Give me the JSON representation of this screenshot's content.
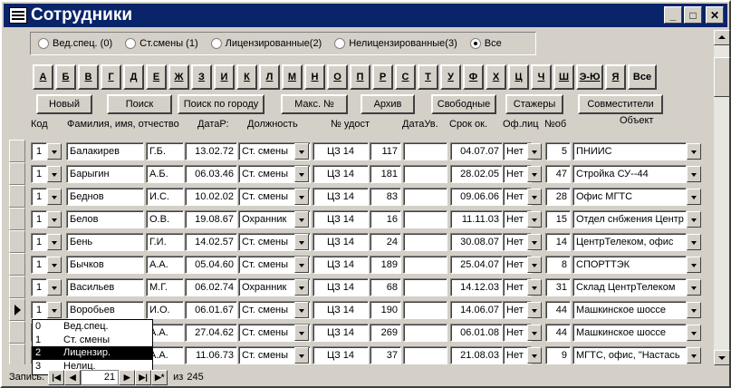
{
  "window": {
    "title": "Сотрудники"
  },
  "filter_options": [
    {
      "label": "Вед.спец. (0)",
      "selected": false
    },
    {
      "label": "Ст.смены (1)",
      "selected": false
    },
    {
      "label": "Лицензированные(2)",
      "selected": false
    },
    {
      "label": "Нелицензированные(3)",
      "selected": false
    },
    {
      "label": "Все",
      "selected": true
    }
  ],
  "letters": [
    "А",
    "Б",
    "В",
    "Г",
    "Д",
    "Е",
    "Ж",
    "З",
    "И",
    "К",
    "Л",
    "М",
    "Н",
    "О",
    "П",
    "Р",
    "С",
    "Т",
    "У",
    "Ф",
    "Х",
    "Ц",
    "Ч",
    "Ш",
    "Э-Ю",
    "Я",
    "Все"
  ],
  "actions": [
    "Новый",
    "Поиск",
    "Поиск по городу",
    "Макс. №",
    "Архив",
    "Свободные",
    "Стажеры",
    "Совместители"
  ],
  "columns": {
    "kod": "Код",
    "fio": "Фамилия, имя, отчество",
    "dob": "ДатаР:",
    "position": "Должность",
    "cert_no": "№ удост",
    "cert_date": "ДатаУв.",
    "term": "Срок ок.",
    "lic": "Оф.лиц",
    "no": "№об",
    "object": "Объект"
  },
  "rows": [
    {
      "kod": "1",
      "surname": "Балакирев",
      "initials": "Г.Б.",
      "dob": "13.02.72",
      "position": "Ст. смены",
      "cert": "ЦЗ 14",
      "num": "117",
      "cert_date": "",
      "term": "04.07.07",
      "lic": "Нет",
      "no": "5",
      "object": "ПНИИС"
    },
    {
      "kod": "1",
      "surname": "Барыгин",
      "initials": "А.Б.",
      "dob": "06.03.46",
      "position": "Ст. смены",
      "cert": "ЦЗ 14",
      "num": "181",
      "cert_date": "",
      "term": "28.02.05",
      "lic": "Нет",
      "no": "47",
      "object": "Стройка СУ--44"
    },
    {
      "kod": "1",
      "surname": "Беднов",
      "initials": "И.С.",
      "dob": "10.02.02",
      "position": "Ст. смены",
      "cert": "ЦЗ 14",
      "num": "83",
      "cert_date": "",
      "term": "09.06.06",
      "lic": "Нет",
      "no": "28",
      "object": "Офис МГТС"
    },
    {
      "kod": "1",
      "surname": "Белов",
      "initials": "О.В.",
      "dob": "19.08.67",
      "position": "Охранник",
      "cert": "ЦЗ 14",
      "num": "16",
      "cert_date": "",
      "term": "11.11.03",
      "lic": "Нет",
      "no": "15",
      "object": "Отдел снбжения Центр"
    },
    {
      "kod": "1",
      "surname": "Бень",
      "initials": "Г.И.",
      "dob": "14.02.57",
      "position": "Ст. смены",
      "cert": "ЦЗ 14",
      "num": "24",
      "cert_date": "",
      "term": "30.08.07",
      "lic": "Нет",
      "no": "14",
      "object": "ЦентрТелеком, офис"
    },
    {
      "kod": "1",
      "surname": "Бычков",
      "initials": "А.А.",
      "dob": "05.04.60",
      "position": "Ст. смены",
      "cert": "ЦЗ 14",
      "num": "189",
      "cert_date": "",
      "term": "25.04.07",
      "lic": "Нет",
      "no": "8",
      "object": "СПОРТТЭК"
    },
    {
      "kod": "1",
      "surname": "Васильев",
      "initials": "М.Г.",
      "dob": "06.02.74",
      "position": "Охранник",
      "cert": "ЦЗ 14",
      "num": "68",
      "cert_date": "",
      "term": "14.12.03",
      "lic": "Нет",
      "no": "31",
      "object": "Склад ЦентрТелеком"
    },
    {
      "kod": "1",
      "surname": "Воробьев",
      "initials": "И.О.",
      "dob": "06.01.67",
      "position": "Ст. смены",
      "cert": "ЦЗ 14",
      "num": "190",
      "cert_date": "",
      "term": "14.06.07",
      "lic": "Нет",
      "no": "44",
      "object": "Машкинское шоссе"
    },
    {
      "kod": "",
      "surname": "",
      "initials": "А.А.",
      "dob": "27.04.62",
      "position": "Ст. смены",
      "cert": "ЦЗ 14",
      "num": "269",
      "cert_date": "",
      "term": "06.01.08",
      "lic": "Нет",
      "no": "44",
      "object": "Машкинское шоссе"
    },
    {
      "kod": "",
      "surname": "",
      "initials": "А.А.",
      "dob": "11.06.73",
      "position": "Ст. смены",
      "cert": "ЦЗ 14",
      "num": "37",
      "cert_date": "",
      "term": "21.08.03",
      "lic": "Нет",
      "no": "9",
      "object": "МГТС, офис, \"Настась"
    }
  ],
  "kod_popup": [
    {
      "key": "0",
      "label": "Вед.спец.",
      "selected": false
    },
    {
      "key": "1",
      "label": "Ст. смены",
      "selected": false
    },
    {
      "key": "2",
      "label": "Лицензир.",
      "selected": true
    },
    {
      "key": "3",
      "label": "Нелиц.",
      "selected": false
    }
  ],
  "navigation": {
    "label": "Запись:",
    "current": "21",
    "of_label": "из",
    "total": "245"
  }
}
